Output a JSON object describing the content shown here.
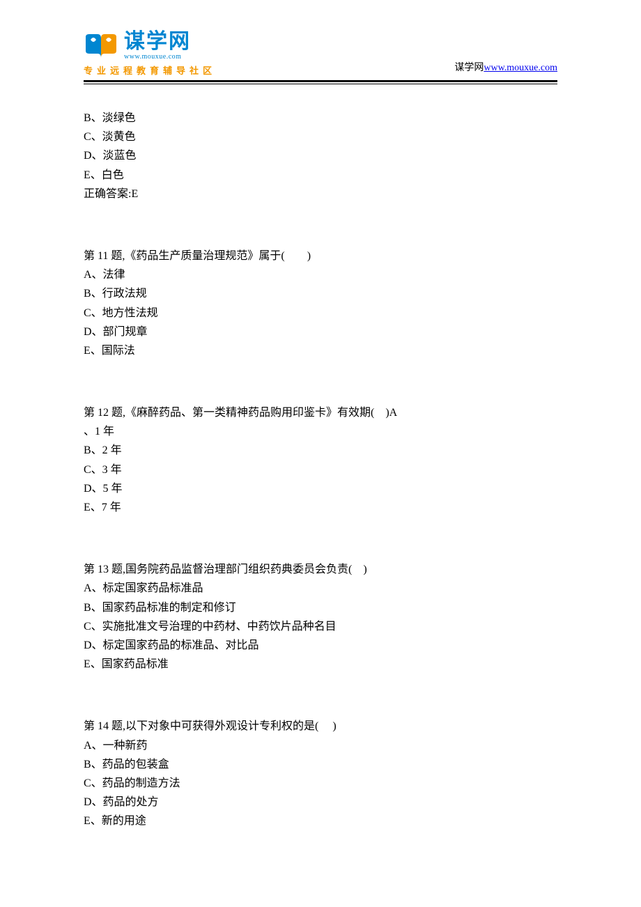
{
  "header": {
    "logo_main": "谋学网",
    "logo_url_small": "www.mouxue.com",
    "logo_tagline": "专业远程教育辅导社区",
    "site_label": "谋学网",
    "site_url": "www.mouxue.com"
  },
  "partial_question": {
    "options": [
      "B、淡绿色",
      "C、淡黄色",
      "D、淡蓝色",
      "E、白色"
    ],
    "answer_label": "正确答案:E"
  },
  "questions": [
    {
      "title": "第 11 题,《药品生产质量治理规范》属于(        )",
      "options": [
        "A、法律",
        "B、行政法规",
        "C、地方性法规",
        "D、部门规章",
        "E、国际法"
      ]
    },
    {
      "title": "第 12 题,《麻醉药品、第一类精神药品购用印鉴卡》有效期(    )A",
      "options": [
        "、1 年",
        "B、2 年",
        "C、3 年",
        "D、5 年",
        "E、7 年"
      ]
    },
    {
      "title": "第 13 题,国务院药品监督治理部门组织药典委员会负责(    )",
      "options": [
        "A、标定国家药品标准品",
        "B、国家药品标准的制定和修订",
        "C、实施批准文号治理的中药材、中药饮片品种名目",
        "D、标定国家药品的标准品、对比品",
        "E、国家药品标准"
      ]
    },
    {
      "title": "第 14 题,以下对象中可获得外观设计专利权的是(     )",
      "options": [
        "A、一种新药",
        "B、药品的包装盒",
        "C、药品的制造方法",
        "D、药品的处方",
        "E、新的用途"
      ]
    }
  ]
}
